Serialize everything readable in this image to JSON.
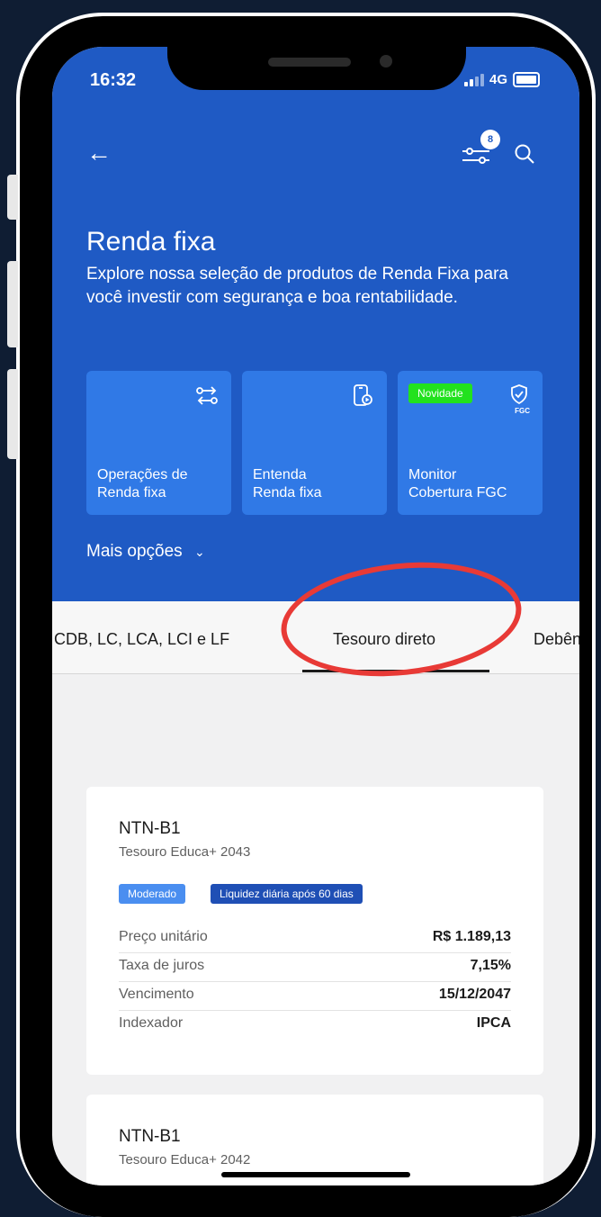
{
  "status_bar": {
    "time": "16:32",
    "network": "4G"
  },
  "header": {
    "filter_count": "8",
    "title": "Renda fixa",
    "subtitle": "Explore nossa seleção de produtos de Renda Fixa para você investir com segurança e boa rentabilidade."
  },
  "cards": [
    {
      "label_line1": "Operações de",
      "label_line2": "Renda fixa",
      "icon": "swap-arrows-icon"
    },
    {
      "label_line1": "Entenda",
      "label_line2": "Renda fixa",
      "icon": "phone-play-icon"
    },
    {
      "label_line1": "Monitor",
      "label_line2": "Cobertura FGC",
      "badge": "Novidade",
      "icon": "shield-check-icon",
      "icon_caption": "FGC"
    }
  ],
  "more_options": "Mais opções",
  "tabs": [
    {
      "label": "CDB, LC, LCA, LCI e LF"
    },
    {
      "label": "Tesouro direto",
      "active": true
    },
    {
      "label": "Debên"
    }
  ],
  "funds": [
    {
      "title": "NTN-B1",
      "subtitle": "Tesouro Educa+ 2043",
      "risk_badge": "Moderado",
      "liquidity_badge": "Liquidez diária após 60 dias",
      "rows": [
        {
          "label": "Preço unitário",
          "value": "R$ 1.189,13"
        },
        {
          "label": "Taxa de juros",
          "value": "7,15%"
        },
        {
          "label": "Vencimento",
          "value": "15/12/2047"
        },
        {
          "label": "Indexador",
          "value": "IPCA"
        }
      ]
    },
    {
      "title": "NTN-B1",
      "subtitle": "Tesouro Educa+ 2042"
    }
  ],
  "colors": {
    "header_bg": "#1f5ac4",
    "card_bg": "#3079e6",
    "novidade": "#22e21e",
    "risk_badge": "#4a8ef0",
    "liquidity_badge": "#1f4fb5",
    "highlight": "#e83a36"
  }
}
